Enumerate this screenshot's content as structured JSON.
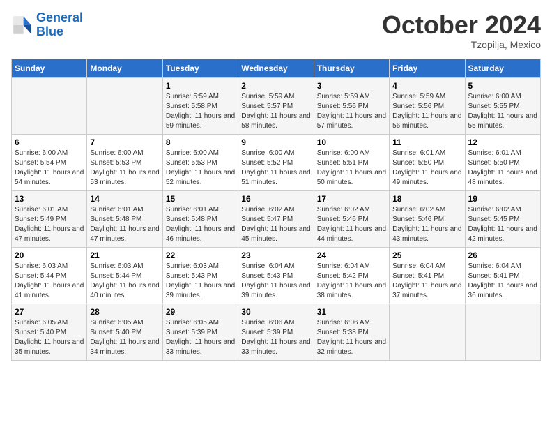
{
  "header": {
    "logo_line1": "General",
    "logo_line2": "Blue",
    "month": "October 2024",
    "location": "Tzopilja, Mexico"
  },
  "weekdays": [
    "Sunday",
    "Monday",
    "Tuesday",
    "Wednesday",
    "Thursday",
    "Friday",
    "Saturday"
  ],
  "weeks": [
    [
      {
        "day": "",
        "info": ""
      },
      {
        "day": "",
        "info": ""
      },
      {
        "day": "1",
        "info": "Sunrise: 5:59 AM\nSunset: 5:58 PM\nDaylight: 11 hours and 59 minutes."
      },
      {
        "day": "2",
        "info": "Sunrise: 5:59 AM\nSunset: 5:57 PM\nDaylight: 11 hours and 58 minutes."
      },
      {
        "day": "3",
        "info": "Sunrise: 5:59 AM\nSunset: 5:56 PM\nDaylight: 11 hours and 57 minutes."
      },
      {
        "day": "4",
        "info": "Sunrise: 5:59 AM\nSunset: 5:56 PM\nDaylight: 11 hours and 56 minutes."
      },
      {
        "day": "5",
        "info": "Sunrise: 6:00 AM\nSunset: 5:55 PM\nDaylight: 11 hours and 55 minutes."
      }
    ],
    [
      {
        "day": "6",
        "info": "Sunrise: 6:00 AM\nSunset: 5:54 PM\nDaylight: 11 hours and 54 minutes."
      },
      {
        "day": "7",
        "info": "Sunrise: 6:00 AM\nSunset: 5:53 PM\nDaylight: 11 hours and 53 minutes."
      },
      {
        "day": "8",
        "info": "Sunrise: 6:00 AM\nSunset: 5:53 PM\nDaylight: 11 hours and 52 minutes."
      },
      {
        "day": "9",
        "info": "Sunrise: 6:00 AM\nSunset: 5:52 PM\nDaylight: 11 hours and 51 minutes."
      },
      {
        "day": "10",
        "info": "Sunrise: 6:00 AM\nSunset: 5:51 PM\nDaylight: 11 hours and 50 minutes."
      },
      {
        "day": "11",
        "info": "Sunrise: 6:01 AM\nSunset: 5:50 PM\nDaylight: 11 hours and 49 minutes."
      },
      {
        "day": "12",
        "info": "Sunrise: 6:01 AM\nSunset: 5:50 PM\nDaylight: 11 hours and 48 minutes."
      }
    ],
    [
      {
        "day": "13",
        "info": "Sunrise: 6:01 AM\nSunset: 5:49 PM\nDaylight: 11 hours and 47 minutes."
      },
      {
        "day": "14",
        "info": "Sunrise: 6:01 AM\nSunset: 5:48 PM\nDaylight: 11 hours and 47 minutes."
      },
      {
        "day": "15",
        "info": "Sunrise: 6:01 AM\nSunset: 5:48 PM\nDaylight: 11 hours and 46 minutes."
      },
      {
        "day": "16",
        "info": "Sunrise: 6:02 AM\nSunset: 5:47 PM\nDaylight: 11 hours and 45 minutes."
      },
      {
        "day": "17",
        "info": "Sunrise: 6:02 AM\nSunset: 5:46 PM\nDaylight: 11 hours and 44 minutes."
      },
      {
        "day": "18",
        "info": "Sunrise: 6:02 AM\nSunset: 5:46 PM\nDaylight: 11 hours and 43 minutes."
      },
      {
        "day": "19",
        "info": "Sunrise: 6:02 AM\nSunset: 5:45 PM\nDaylight: 11 hours and 42 minutes."
      }
    ],
    [
      {
        "day": "20",
        "info": "Sunrise: 6:03 AM\nSunset: 5:44 PM\nDaylight: 11 hours and 41 minutes."
      },
      {
        "day": "21",
        "info": "Sunrise: 6:03 AM\nSunset: 5:44 PM\nDaylight: 11 hours and 40 minutes."
      },
      {
        "day": "22",
        "info": "Sunrise: 6:03 AM\nSunset: 5:43 PM\nDaylight: 11 hours and 39 minutes."
      },
      {
        "day": "23",
        "info": "Sunrise: 6:04 AM\nSunset: 5:43 PM\nDaylight: 11 hours and 39 minutes."
      },
      {
        "day": "24",
        "info": "Sunrise: 6:04 AM\nSunset: 5:42 PM\nDaylight: 11 hours and 38 minutes."
      },
      {
        "day": "25",
        "info": "Sunrise: 6:04 AM\nSunset: 5:41 PM\nDaylight: 11 hours and 37 minutes."
      },
      {
        "day": "26",
        "info": "Sunrise: 6:04 AM\nSunset: 5:41 PM\nDaylight: 11 hours and 36 minutes."
      }
    ],
    [
      {
        "day": "27",
        "info": "Sunrise: 6:05 AM\nSunset: 5:40 PM\nDaylight: 11 hours and 35 minutes."
      },
      {
        "day": "28",
        "info": "Sunrise: 6:05 AM\nSunset: 5:40 PM\nDaylight: 11 hours and 34 minutes."
      },
      {
        "day": "29",
        "info": "Sunrise: 6:05 AM\nSunset: 5:39 PM\nDaylight: 11 hours and 33 minutes."
      },
      {
        "day": "30",
        "info": "Sunrise: 6:06 AM\nSunset: 5:39 PM\nDaylight: 11 hours and 33 minutes."
      },
      {
        "day": "31",
        "info": "Sunrise: 6:06 AM\nSunset: 5:38 PM\nDaylight: 11 hours and 32 minutes."
      },
      {
        "day": "",
        "info": ""
      },
      {
        "day": "",
        "info": ""
      }
    ]
  ]
}
